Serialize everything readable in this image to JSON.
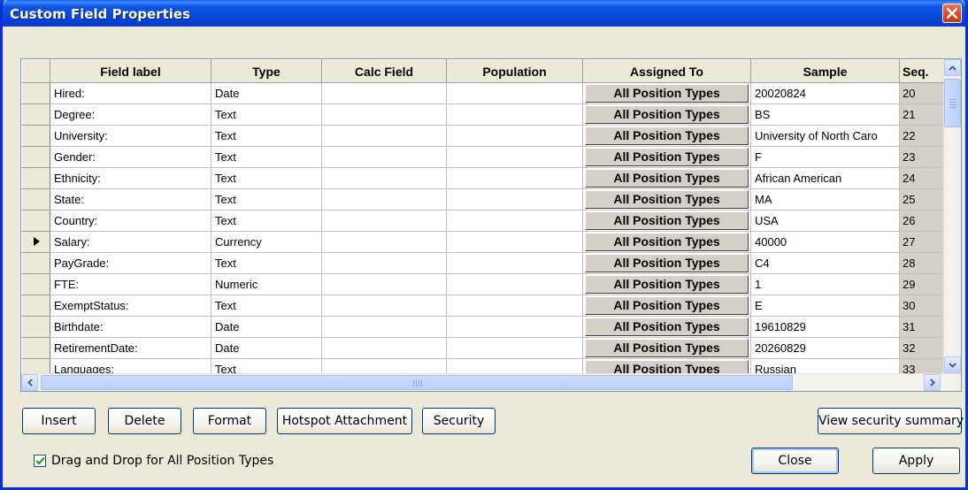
{
  "window": {
    "title": "Custom Field Properties"
  },
  "grid": {
    "columns": [
      "Field label",
      "Type",
      "Calc Field",
      "Population",
      "Assigned To",
      "Sample",
      "Seq."
    ],
    "rows": [
      {
        "label": "Hired:",
        "type": "Date",
        "calc": "",
        "population": "",
        "assigned": "All Position Types",
        "sample": "20020824",
        "seq": "20"
      },
      {
        "label": "Degree:",
        "type": "Text",
        "calc": "",
        "population": "",
        "assigned": "All Position Types",
        "sample": "BS",
        "seq": "21"
      },
      {
        "label": "University:",
        "type": "Text",
        "calc": "",
        "population": "",
        "assigned": "All Position Types",
        "sample": "University of North Caro",
        "seq": "22"
      },
      {
        "label": "Gender:",
        "type": "Text",
        "calc": "",
        "population": "",
        "assigned": "All Position Types",
        "sample": "F",
        "seq": "23"
      },
      {
        "label": "Ethnicity:",
        "type": "Text",
        "calc": "",
        "population": "",
        "assigned": "All Position Types",
        "sample": "African American",
        "seq": "24"
      },
      {
        "label": "State:",
        "type": "Text",
        "calc": "",
        "population": "",
        "assigned": "All Position Types",
        "sample": "MA",
        "seq": "25"
      },
      {
        "label": "Country:",
        "type": "Text",
        "calc": "",
        "population": "",
        "assigned": "All Position Types",
        "sample": "USA",
        "seq": "26"
      },
      {
        "label": "Salary:",
        "type": "Currency",
        "calc": "",
        "population": "",
        "assigned": "All Position Types",
        "sample": "40000",
        "seq": "27",
        "current": true
      },
      {
        "label": "PayGrade:",
        "type": "Text",
        "calc": "",
        "population": "",
        "assigned": "All Position Types",
        "sample": "C4",
        "seq": "28"
      },
      {
        "label": "FTE:",
        "type": "Numeric",
        "calc": "",
        "population": "",
        "assigned": "All Position Types",
        "sample": "1",
        "seq": "29"
      },
      {
        "label": "ExemptStatus:",
        "type": "Text",
        "calc": "",
        "population": "",
        "assigned": "All Position Types",
        "sample": "E",
        "seq": "30"
      },
      {
        "label": "Birthdate:",
        "type": "Date",
        "calc": "",
        "population": "",
        "assigned": "All Position Types",
        "sample": "19610829",
        "seq": "31"
      },
      {
        "label": "RetirementDate:",
        "type": "Date",
        "calc": "",
        "population": "",
        "assigned": "All Position Types",
        "sample": "20260829",
        "seq": "32"
      },
      {
        "label": "Languages:",
        "type": "Text",
        "calc": "",
        "population": "",
        "assigned": "All Position Types",
        "sample": "Russian",
        "seq": "33"
      }
    ]
  },
  "buttons": {
    "insert": "Insert",
    "delete": "Delete",
    "format": "Format",
    "hotspot": "Hotspot Attachment",
    "security": "Security",
    "view_security_summary": "View security summary",
    "close": "Close",
    "apply": "Apply"
  },
  "checkbox": {
    "label": "Drag and Drop for All Position Types",
    "checked": true
  },
  "colors": {
    "titlebar": "#0a4ae0",
    "window_bg": "#ece9d8",
    "close_red": "#d44a27"
  }
}
